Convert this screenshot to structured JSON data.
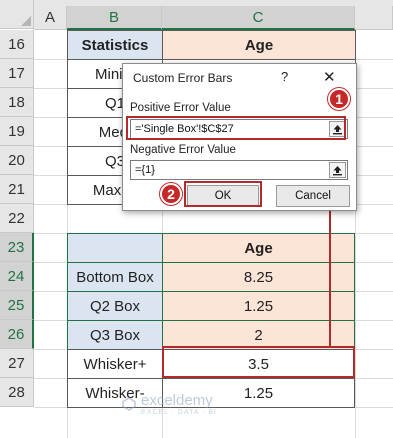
{
  "columns": [
    "A",
    "B",
    "C"
  ],
  "rows": [
    "16",
    "17",
    "18",
    "19",
    "20",
    "21",
    "22",
    "23",
    "24",
    "25",
    "26",
    "27",
    "28"
  ],
  "stats_table": {
    "header": [
      "Statistics",
      "Age"
    ],
    "labels": [
      "Minim",
      "Q1",
      "Medi",
      "Q3",
      "Maxim"
    ]
  },
  "box_table": {
    "header": [
      "",
      "Age"
    ],
    "rows": [
      [
        "Bottom Box",
        "8.25"
      ],
      [
        "Q2 Box",
        "1.25"
      ],
      [
        "Q3 Box",
        "2"
      ],
      [
        "Whisker+",
        "3.5"
      ],
      [
        "Whisker-",
        "1.25"
      ]
    ]
  },
  "dialog": {
    "title": "Custom Error Bars",
    "help": "?",
    "close": "✕",
    "positive_label": "Positive Error Value",
    "positive_value": "='Single Box'!$C$27",
    "negative_label": "Negative Error Value",
    "negative_value": "={1}",
    "ok_label": "OK",
    "cancel_label": "Cancel"
  },
  "badges": [
    "1",
    "2"
  ],
  "watermark": {
    "name": "exceldemy",
    "sub": "EXCEL · DATA · BI"
  },
  "colors": {
    "accent_green": "#217346",
    "header_blue": "#dbe5f1",
    "header_peach": "#fce4d6",
    "annotation_red": "#b22a2a"
  }
}
